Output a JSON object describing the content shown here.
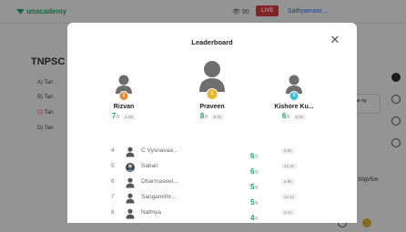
{
  "background": {
    "logo_text": "unacademy",
    "viewers": "👁 90",
    "live_badge": "LIVE",
    "teacher_name": "Sathyamoor...",
    "quiz_title": "TNPSC",
    "options": [
      {
        "letter": "A)",
        "text": "Tan"
      },
      {
        "letter": "B)",
        "text": "Tan"
      },
      {
        "letter": "C)",
        "text": "Tan"
      },
      {
        "letter": "D)",
        "text": "Tan"
      }
    ],
    "tooltip_text": "to the ng your",
    "code_text": "30gV5m"
  },
  "modal": {
    "title": "Leaderboard",
    "close_glyph": "✕"
  },
  "podium": [
    {
      "rank": "2",
      "name": "Rizvan",
      "score": "7",
      "out_of": "/8",
      "time": "1.9s",
      "medal_color": "#e08a3a"
    },
    {
      "rank": "1",
      "name": "Praveen",
      "score": "8",
      "out_of": "/8",
      "time": "8.3s",
      "medal_color": "#e8b730"
    },
    {
      "rank": "3",
      "name": "Kishore Ku...",
      "score": "6",
      "out_of": "/8",
      "time": "5.9s",
      "medal_color": "#3cc3d9"
    }
  ],
  "rows": [
    {
      "rank": "4",
      "name": "C Vysnavaa...",
      "score": "6",
      "out_of": "/8",
      "time": "8.0s",
      "avatar": "person"
    },
    {
      "rank": "5",
      "name": "Sabari",
      "score": "6",
      "out_of": "/8",
      "time": "12.3s",
      "avatar": "photo"
    },
    {
      "rank": "6",
      "name": "Dharmaseel...",
      "score": "5",
      "out_of": "/8",
      "time": "4.9s",
      "avatar": "person"
    },
    {
      "rank": "7",
      "name": "Sangamithr...",
      "score": "5",
      "out_of": "/8",
      "time": "12.1s",
      "avatar": "person"
    },
    {
      "rank": "8",
      "name": "Nathiya",
      "score": "4",
      "out_of": "/8",
      "time": "3.1s",
      "avatar": "person"
    }
  ],
  "colors": {
    "score_green": "#1fa36b",
    "live_red": "#e23b3b",
    "brand_green": "#2eb07a"
  }
}
